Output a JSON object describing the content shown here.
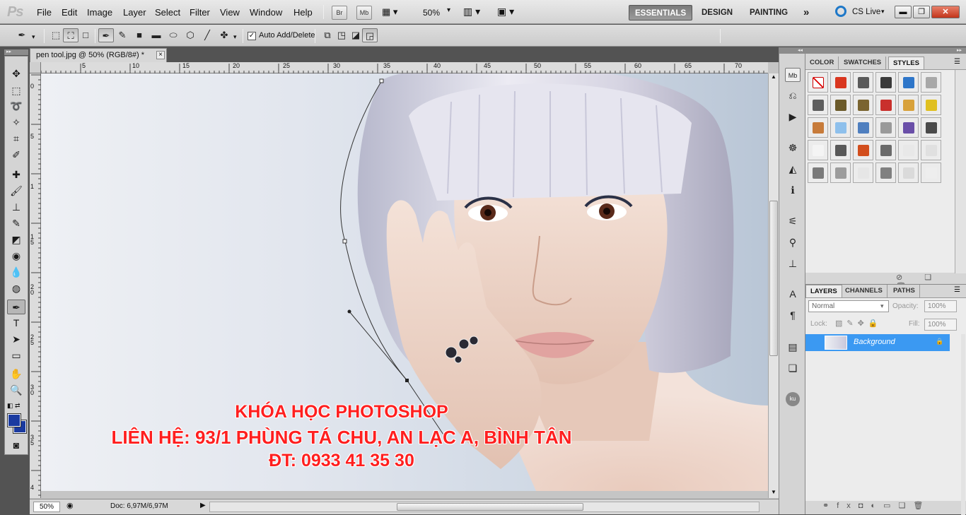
{
  "app": {
    "logo": "Ps"
  },
  "menu": [
    "File",
    "Edit",
    "Image",
    "Layer",
    "Select",
    "Filter",
    "View",
    "Window",
    "Help"
  ],
  "app_bar": {
    "bridge": "Br",
    "minibridge": "Mb",
    "zoom": "50%"
  },
  "workspaces": {
    "essentials": "ESSENTIALS",
    "design": "DESIGN",
    "painting": "PAINTING",
    "more": "»",
    "cs_live": "CS Live"
  },
  "options": {
    "auto_add_delete": "Auto Add/Delete",
    "auto_add_checked": true
  },
  "document": {
    "tab_title": "pen tool.jpg @ 50% (RGB/8#) *",
    "close": "×"
  },
  "ruler": {
    "h_ticks": [
      "5",
      "10",
      "15",
      "20",
      "25",
      "30",
      "35",
      "40",
      "45",
      "50",
      "55",
      "60",
      "65",
      "70"
    ],
    "v_ticks": [
      "0",
      "5",
      "1",
      "1 5",
      "2 0",
      "2 5",
      "3 0",
      "3 5",
      "4"
    ]
  },
  "caption": {
    "line1": "KHÓA HỌC PHOTOSHOP",
    "line2": "LIÊN HỆ: 93/1 PHÙNG TÁ CHU, AN LẠC A, BÌNH TÂN",
    "line3": "ĐT: 0933 41 35 30"
  },
  "status": {
    "zoom": "50%",
    "doc": "Doc: 6,97M/6,97M"
  },
  "styles_panel": {
    "tabs": [
      "COLOR",
      "SWATCHES",
      "STYLES"
    ],
    "active": "STYLES",
    "swatch_colors": [
      "#ffffff",
      "#d9361f",
      "#5a5a5a",
      "#3a3a3a",
      "#2e76c9",
      "#a8a8a8",
      "#5e5e5e",
      "#6b5a2a",
      "#7a6430",
      "#c9302c",
      "#d8a13a",
      "#e0c020",
      "#c77b3a",
      "#8ec0ec",
      "#4f7fbf",
      "#9a9a9a",
      "#6a4fa8",
      "#4a4a4a",
      "#f4f4f4",
      "#585858",
      "#d24e1d",
      "#6a6a6a",
      "#e8e8e8",
      "#e0e0e0",
      "#7a7a7a",
      "#9c9c9c",
      "#e6e6e6",
      "#808080",
      "#dadada",
      "#eeeeee"
    ]
  },
  "layers_panel": {
    "tabs": [
      "LAYERS",
      "CHANNELS",
      "PATHS"
    ],
    "active": "LAYERS",
    "blend_mode": "Normal",
    "opacity_label": "Opacity:",
    "opacity": "100%",
    "lock_label": "Lock:",
    "fill_label": "Fill:",
    "fill": "100%",
    "layer_name": "Background"
  },
  "colors": {
    "accent": "#3b99f2",
    "caption": "#ff1f1f",
    "foreground": "#1a3aa0",
    "background": "#1a3aa0"
  }
}
